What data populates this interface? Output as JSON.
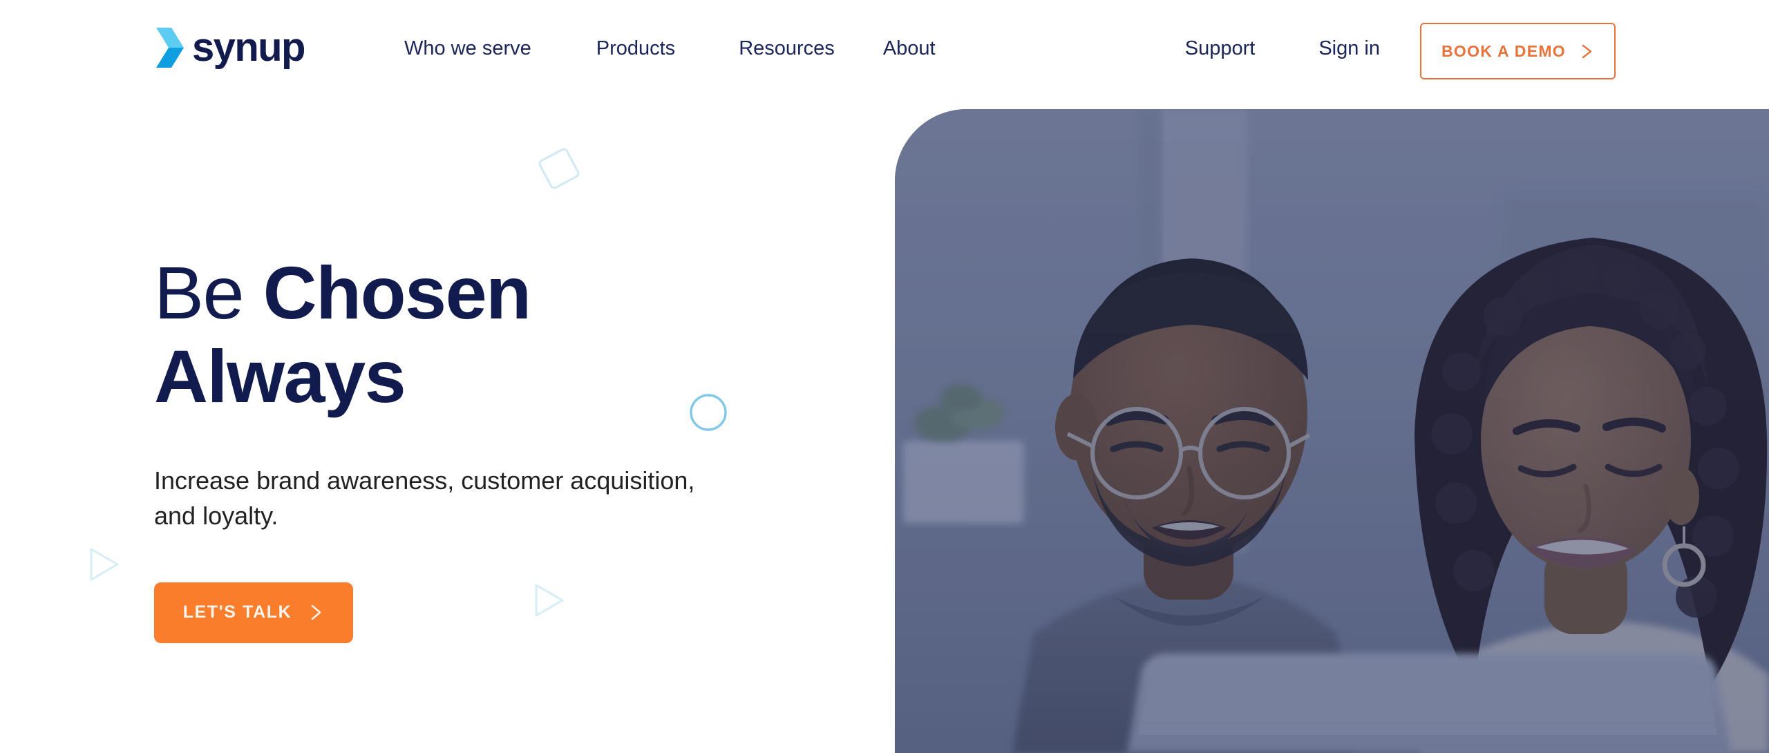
{
  "brand": {
    "name": "synup",
    "mark_icon": "synup-chevron-logo-icon",
    "mark_color_light": "#5ccdf0",
    "mark_color_dark": "#0f9fe0",
    "word_color": "#111b4e"
  },
  "header": {
    "primary_nav": [
      {
        "label": "Who we serve"
      },
      {
        "label": "Products"
      },
      {
        "label": "Resources"
      },
      {
        "label": "About"
      }
    ],
    "secondary_nav": [
      {
        "label": "Support"
      },
      {
        "label": "Sign in"
      }
    ],
    "demo_button": {
      "label": "BOOK A DEMO",
      "icon": "chevron-right-icon",
      "border_color": "#e8733a",
      "text_color": "#e8733a"
    }
  },
  "hero": {
    "title_line1_light": "Be ",
    "title_line1_strong": "Chosen",
    "title_line2": "Always",
    "title_color": "#111b4e",
    "subtitle": "Increase brand awareness, customer acquisition, and loyalty.",
    "cta": {
      "label": "LET'S TALK",
      "icon": "chevron-right-icon",
      "background": "#f97d2b",
      "text_color": "#fdf4ec"
    },
    "decorations": [
      {
        "name": "diamond-outline",
        "color": "#cfe9f5"
      },
      {
        "name": "circle-outline",
        "color": "#7ec8ea"
      },
      {
        "name": "triangle-outline-left",
        "color": "#d6ecf6"
      },
      {
        "name": "triangle-outline-right",
        "color": "#d6ecf6"
      }
    ],
    "image": {
      "alt": "Two colleagues smiling while looking at a laptop screen in a bright office",
      "tint_color": "#56608c"
    }
  }
}
